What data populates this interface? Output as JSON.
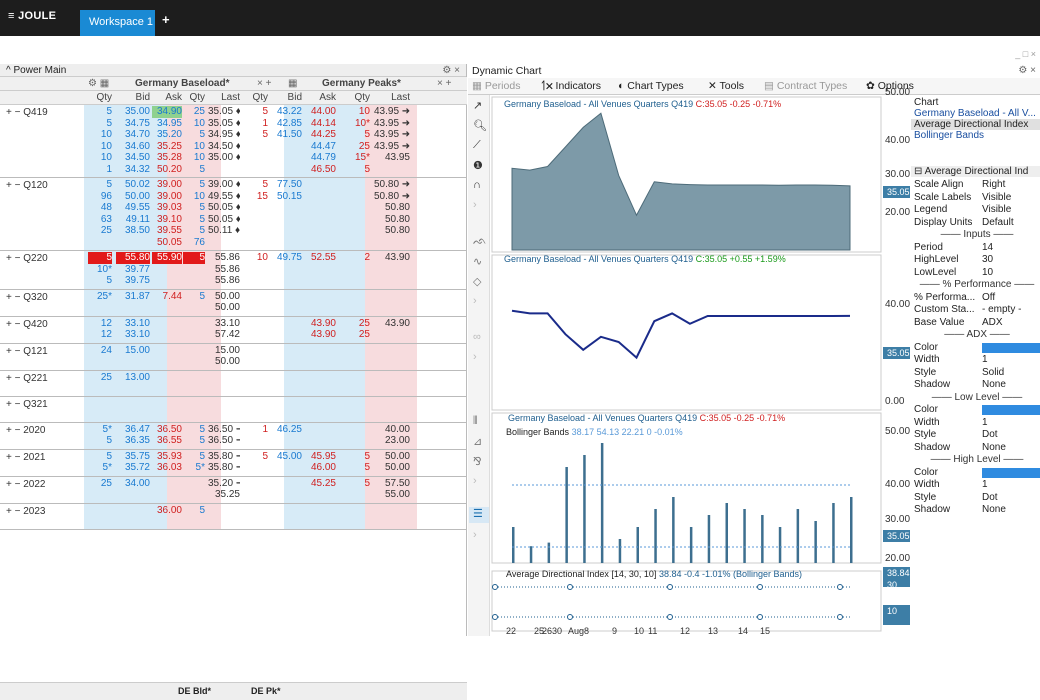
{
  "app": {
    "logo": "≡ JOULE",
    "workspace_tab": "Workspace 1",
    "add_tab": "+",
    "window_controls": "_ □ ×"
  },
  "grid": {
    "title": "Power Main",
    "header_controls": "⚙ ×",
    "sections": [
      {
        "name": "Germany Baseload*",
        "controls": "× +"
      },
      {
        "name": "Germany Peaks*",
        "controls": "× +"
      }
    ],
    "columns": [
      "Qty",
      "Bid",
      "Ask",
      "Qty",
      "Last",
      "Qty",
      "Bid",
      "Ask",
      "Qty",
      "Last"
    ],
    "groups": [
      {
        "label": "+ − Q419",
        "rows": [
          [
            "5",
            "35.00",
            "34.90",
            "25",
            "35.05 ♦",
            "5",
            "43.22",
            "44.00",
            "10",
            "43.95 ➜"
          ],
          [
            "5",
            "34.75",
            "34.95",
            "10",
            "35.05 ♦",
            "1",
            "42.85",
            "44.14",
            "10*",
            "43.95 ➜"
          ],
          [
            "10",
            "34.70",
            "35.20",
            "5",
            "34.95 ♦",
            "5",
            "41.50",
            "44.25",
            "5",
            "43.95 ➜"
          ],
          [
            "10",
            "34.60",
            "35.25",
            "10",
            "34.50 ♦",
            "",
            "",
            "44.47",
            "25",
            "43.95 ➜"
          ],
          [
            "10",
            "34.50",
            "35.28",
            "10",
            "35.00 ♦",
            "",
            "",
            "44.79",
            "15*",
            "43.95"
          ],
          [
            "1",
            "34.32",
            "50.20",
            "5",
            "",
            "",
            "",
            "46.50",
            "5",
            ""
          ]
        ]
      },
      {
        "label": "+ − Q120",
        "rows": [
          [
            "5",
            "50.02",
            "39.00",
            "5",
            "39.00 ♦",
            "5",
            "77.50",
            "",
            "",
            "50.80 ➜"
          ],
          [
            "96",
            "50.00",
            "39.00",
            "10",
            "49.55 ♦",
            "15",
            "50.15",
            "",
            "",
            "50.80 ➜"
          ],
          [
            "48",
            "49.55",
            "39.03",
            "5",
            "50.05 ♦",
            "",
            "",
            "",
            "",
            "50.80"
          ],
          [
            "63",
            "49.11",
            "39.10",
            "5",
            "50.05 ♦",
            "",
            "",
            "",
            "",
            "50.80"
          ],
          [
            "25",
            "38.50",
            "39.55",
            "5",
            "50.11 ♦",
            "",
            "",
            "",
            "",
            "50.80"
          ],
          [
            "",
            "",
            "50.05",
            "76",
            "",
            "",
            "",
            "",
            "",
            ""
          ]
        ]
      },
      {
        "label": "+ − Q220",
        "rows": [
          [
            "5",
            "55.80",
            "55.90",
            "5",
            "55.86",
            "10",
            "49.75",
            "52.55",
            "2",
            "43.90"
          ],
          [
            "10*",
            "39.77",
            "",
            "",
            "55.86",
            "",
            "",
            "",
            "",
            ""
          ],
          [
            "5",
            "39.75",
            "",
            "",
            "55.86",
            "",
            "",
            "",
            "",
            ""
          ]
        ]
      },
      {
        "label": "+ − Q320",
        "rows": [
          [
            "25*",
            "31.87",
            "7.44",
            "5",
            "50.00",
            "",
            "",
            "",
            "",
            ""
          ],
          [
            "",
            "",
            "",
            "",
            "50.00",
            "",
            "",
            "",
            "",
            ""
          ]
        ]
      },
      {
        "label": "+ − Q420",
        "rows": [
          [
            "12",
            "33.10",
            "",
            "",
            "33.10",
            "",
            "",
            "43.90",
            "25",
            "43.90"
          ],
          [
            "12",
            "33.10",
            "",
            "",
            "57.42",
            "",
            "",
            "43.90",
            "25",
            ""
          ]
        ]
      },
      {
        "label": "+ − Q121",
        "rows": [
          [
            "24",
            "15.00",
            "",
            "",
            "15.00",
            "",
            "",
            "",
            "",
            ""
          ],
          [
            "",
            "",
            "",
            "",
            "50.00",
            "",
            "",
            "",
            "",
            ""
          ]
        ]
      },
      {
        "label": "+ − Q221",
        "rows": [
          [
            "25",
            "13.00",
            "",
            "",
            "",
            "",
            "",
            "",
            "",
            ""
          ]
        ]
      },
      {
        "label": "+ − Q321",
        "rows": [
          [
            "",
            "",
            "",
            "",
            "",
            "",
            "",
            "",
            "",
            ""
          ]
        ]
      },
      {
        "label": "+ − 2020",
        "rows": [
          [
            "5*",
            "36.47",
            "36.50",
            "5",
            "36.50 ➜",
            "1",
            "46.25",
            "",
            "",
            "40.00"
          ],
          [
            "5",
            "36.35",
            "36.55",
            "5",
            "36.50 ➜",
            "",
            "",
            "",
            "",
            "23.00"
          ]
        ]
      },
      {
        "label": "+ − 2021",
        "rows": [
          [
            "5",
            "35.75",
            "35.93",
            "5",
            "35.80 ➜",
            "5",
            "45.00",
            "45.95",
            "5",
            "50.00"
          ],
          [
            "5*",
            "35.72",
            "36.03",
            "5*",
            "35.80 ➜",
            "",
            "",
            "46.00",
            "5",
            "50.00"
          ]
        ]
      },
      {
        "label": "+ − 2022",
        "rows": [
          [
            "25",
            "34.00",
            "",
            "",
            "35.20 ➜",
            "",
            "",
            "45.25",
            "5",
            "57.50"
          ],
          [
            "",
            "",
            "",
            "",
            "35.25",
            "",
            "",
            "",
            "",
            "55.00"
          ]
        ]
      },
      {
        "label": "+ − 2023",
        "rows": [
          [
            "",
            "",
            "36.00",
            "5",
            "",
            "",
            "",
            "",
            "",
            ""
          ]
        ]
      }
    ],
    "footer_tabs": [
      "DE Bld*",
      "DE Pk*"
    ]
  },
  "chart": {
    "title": "Dynamic Chart",
    "title_controls": "⚙ ×",
    "toolbar": {
      "periods": "Periods",
      "indicators": "Indicators",
      "chart_types": "Chart Types",
      "tools": "Tools",
      "contract_types": "Contract Types",
      "options": "Options"
    },
    "panes": [
      {
        "legend": "Germany Baseload - All Venues Quarters Q419",
        "stats": "C:35.05 -0.25 -0.71%",
        "unit": "€MW",
        "yticks": [
          "50.00",
          "40.00",
          "30.00",
          "20.00"
        ],
        "badge": "35.05"
      },
      {
        "legend": "Germany Baseload - All Venues Quarters Q419",
        "stats": "C:35.05 +0.55 +1.59%",
        "unit": "€MW",
        "yticks": [
          "40.00",
          "20.00",
          "0.00"
        ],
        "badge": "35.05"
      },
      {
        "legend": "Germany Baseload - All Venues Quarters Q419",
        "stats": "C:35.05 -0.25 -0.71%",
        "legend2": "Bollinger Bands",
        "stats2": "38.17 54.13 22.21 0 -0.01%",
        "unit": "€MW",
        "yticks": [
          "50.00",
          "40.00",
          "30.00",
          "20.00"
        ],
        "badge": "35.05"
      },
      {
        "legend": "Average Directional Index [14, 30, 10]",
        "stats": "38.84 -0.4 -1.01% (Bollinger Bands)",
        "badge": "38.84 30",
        "badge2": "10"
      }
    ],
    "xticks": [
      "22",
      "25",
      "26",
      "30",
      "Aug",
      "8",
      "9",
      "10",
      "11",
      "12",
      "13",
      "14",
      "15"
    ],
    "chart_data": {
      "type": "area",
      "series": [
        {
          "name": "Germany Baseload - All Venues Quarters Q419",
          "values": [
            40.0,
            39.5,
            40.5,
            46,
            51.5,
            55.5,
            38,
            26.8,
            36.2,
            35.6,
            35.4,
            35.3,
            35.3,
            35.3,
            35.3,
            35.2,
            35.3,
            35.3,
            35.2,
            35.05
          ]
        }
      ],
      "ylim": [
        17,
        55
      ]
    }
  },
  "props": {
    "chart_header": "Chart",
    "chart_items": [
      "Germany Baseload - All V...",
      "Average Directional Index",
      "Bollinger Bands"
    ],
    "section_title": "⊟ Average Directional Ind",
    "rows1": [
      [
        "Scale Align",
        "Right"
      ],
      [
        "Scale Labels",
        "Visible"
      ],
      [
        "Legend",
        "Visible"
      ],
      [
        "Display Units",
        "Default"
      ]
    ],
    "inputs_label": "Inputs",
    "rows2": [
      [
        "Period",
        "14"
      ],
      [
        "HighLevel",
        "30"
      ],
      [
        "LowLevel",
        "10"
      ]
    ],
    "perf_label": "% Performance",
    "rows3": [
      [
        "% Performa...",
        "Off"
      ],
      [
        "Custom Sta...",
        "- empty -"
      ],
      [
        "Base Value",
        "ADX"
      ]
    ],
    "adx_label": "ADX",
    "rows4": [
      [
        "Color",
        ""
      ],
      [
        "Width",
        "1"
      ],
      [
        "Style",
        "Solid"
      ],
      [
        "Shadow",
        "None"
      ]
    ],
    "low_label": "Low Level",
    "rows5": [
      [
        "Color",
        ""
      ],
      [
        "Width",
        "1"
      ],
      [
        "Style",
        "Dot"
      ],
      [
        "Shadow",
        "None"
      ]
    ],
    "high_label": "High Level",
    "rows6": [
      [
        "Color",
        ""
      ],
      [
        "Width",
        "1"
      ],
      [
        "Style",
        "Dot"
      ],
      [
        "Shadow",
        "None"
      ]
    ]
  }
}
